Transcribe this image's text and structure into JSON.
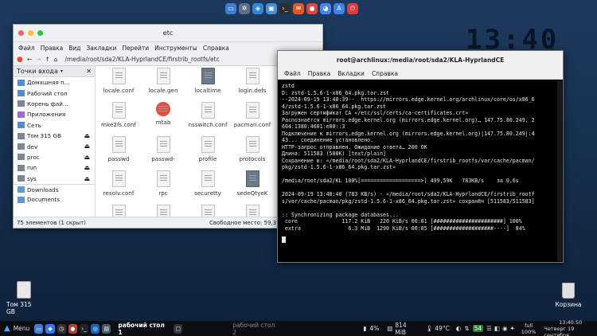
{
  "desktop": {
    "clock_big": "13:40",
    "drive_icon_label": "Том 315 GB",
    "trash_label": "Корзина"
  },
  "dock": {
    "icons": [
      "folder-icon",
      "settings-icon",
      "network-icon",
      "gallery-icon",
      "terminal-icon",
      "browser-icon",
      "mail-icon",
      "store-icon",
      "appstore-icon",
      "power-icon"
    ]
  },
  "file_manager": {
    "title": "etc",
    "menu": [
      "Файл",
      "Правка",
      "Вид",
      "Закладки",
      "Перейти",
      "Инструменты",
      "Справка"
    ],
    "location": "/media/root/sda2/KLA-HyprlandCE/firstrib_rootfs/etc",
    "sidebar_header": "Точки входа",
    "sidebar_items": [
      {
        "label": "Домашняя п...",
        "icon": "home-icon",
        "eject": false
      },
      {
        "label": "Рабочий стол",
        "icon": "desktop-icon",
        "eject": false
      },
      {
        "label": "Корень фай...",
        "icon": "drive-icon",
        "eject": false
      },
      {
        "label": "Приложения",
        "icon": "apps-icon",
        "eject": false
      },
      {
        "label": "Сеть",
        "icon": "network-icon",
        "eject": false
      },
      {
        "label": "Том 315 GB",
        "icon": "drive-icon",
        "eject": true
      },
      {
        "label": "dev",
        "icon": "drive-icon",
        "eject": true
      },
      {
        "label": "proc",
        "icon": "drive-icon",
        "eject": true
      },
      {
        "label": "run",
        "icon": "drive-icon",
        "eject": true
      },
      {
        "label": "sys",
        "icon": "drive-icon",
        "eject": true
      },
      {
        "label": "Downloads",
        "icon": "folder-icon",
        "eject": false
      },
      {
        "label": "Documents",
        "icon": "folder-icon",
        "eject": false
      }
    ],
    "files": [
      {
        "name": "locale.conf",
        "type": "doc"
      },
      {
        "name": "locale.gen",
        "type": "doc"
      },
      {
        "name": "localtime",
        "type": "link"
      },
      {
        "name": "login.defs",
        "type": "doc"
      },
      {
        "name": "makep",
        "type": "doc"
      },
      {
        "name": "mke2fs.conf",
        "type": "doc"
      },
      {
        "name": "mtab",
        "type": "broken"
      },
      {
        "name": "nsswitch.conf",
        "type": "doc"
      },
      {
        "name": "pacman.conf",
        "type": "doc"
      },
      {
        "name": "pacma",
        "type": "doc"
      },
      {
        "name": "passwd",
        "type": "doc"
      },
      {
        "name": "passwd-",
        "type": "doc"
      },
      {
        "name": "profile",
        "type": "doc"
      },
      {
        "name": "protocols",
        "type": "doc"
      },
      {
        "name": "requ key.",
        "type": "doc"
      },
      {
        "name": "resolv.conf",
        "type": "doc"
      },
      {
        "name": "rpc",
        "type": "doc"
      },
      {
        "name": "securetty",
        "type": "doc"
      },
      {
        "name": "sedeQtyeK",
        "type": "link"
      },
      {
        "name": "serv",
        "type": "doc"
      },
      {
        "name": "",
        "type": "doc"
      },
      {
        "name": "",
        "type": "doc"
      },
      {
        "name": "",
        "type": "doc"
      },
      {
        "name": "",
        "type": "doc"
      },
      {
        "name": "",
        "type": "doc"
      }
    ],
    "status_left": "75 элементов (1 скрыт)",
    "status_right": "Свободное место: 59,3 Г"
  },
  "terminal": {
    "title": "root@archlinux:/media/root/sda2/KLA-HyprlandCE",
    "menu": [
      "Файл",
      "Правка",
      "Вкладки",
      "Справка"
    ],
    "lines": [
      "zstd",
      "D: zstd-1.5.6-1-x86_64.pkg.tar.zst",
      "--2024-09-19 13:40:39--  https://mirrors.edge.kernel.org/archlinux/core/os/x86_6",
      "4/zstd-1.5.6-1-x86_64.pkg.tar.zst",
      "Загружен сертификат CA «/etc/ssl/certs/ca-certificates.crt»",
      "Распознаётся mirrors.edge.kernel.org (mirrors.edge.kernel.org)… 147.75.80.249, 2",
      "604:1380:4601:e00::3",
      "Подключение к mirrors.edge.kernel.org (mirrors.edge.kernel.org)|147.75.80.249|:4",
      "43... соединение установлено.",
      "HTTP-запрос отправлен. Ожидание ответа… 200 OK",
      "Длина: 511583 (500K) [text/plain]",
      "Сохранение в: «/media/root/sda2/KLA-HyprlandCE/firstrib_rootfs/var/cache/pacman/",
      "pkg/zstd-1.5.6-1-x86_64.pkg.tar.zst»",
      "",
      "/media/root/sda2/KL 100%[===================>] 499,59K   783KB/s    за 0,6s",
      "",
      "2024-09-19 13:40:40 (783 KB/s) - «/media/root/sda2/KLA-HyprlandCE/firstrib_rootf",
      "s/var/cache/pacman/pkg/zstd-1.5.6-1-x86_64.pkg.tar.zst» сохранён [511583/511583]",
      "",
      ":: Synchronizing package databases...",
      " core              117.2 KiB   220 KiB/s 00:01 [######################] 100%",
      " extra               6.3 MiB  1290 KiB/s 00:05 [###################----]  84%"
    ]
  },
  "taskbar": {
    "menu_label": "Menu",
    "task_active": "рабочий стол 1",
    "task_inactive": "рабочий стол 2",
    "cpu": "4%",
    "memory": "814 MiB",
    "temp": "49°C",
    "badge": "54",
    "layout": "full",
    "layout_sub": "100%",
    "time": "13:40:50",
    "date": "Четверг 19 сентября"
  }
}
